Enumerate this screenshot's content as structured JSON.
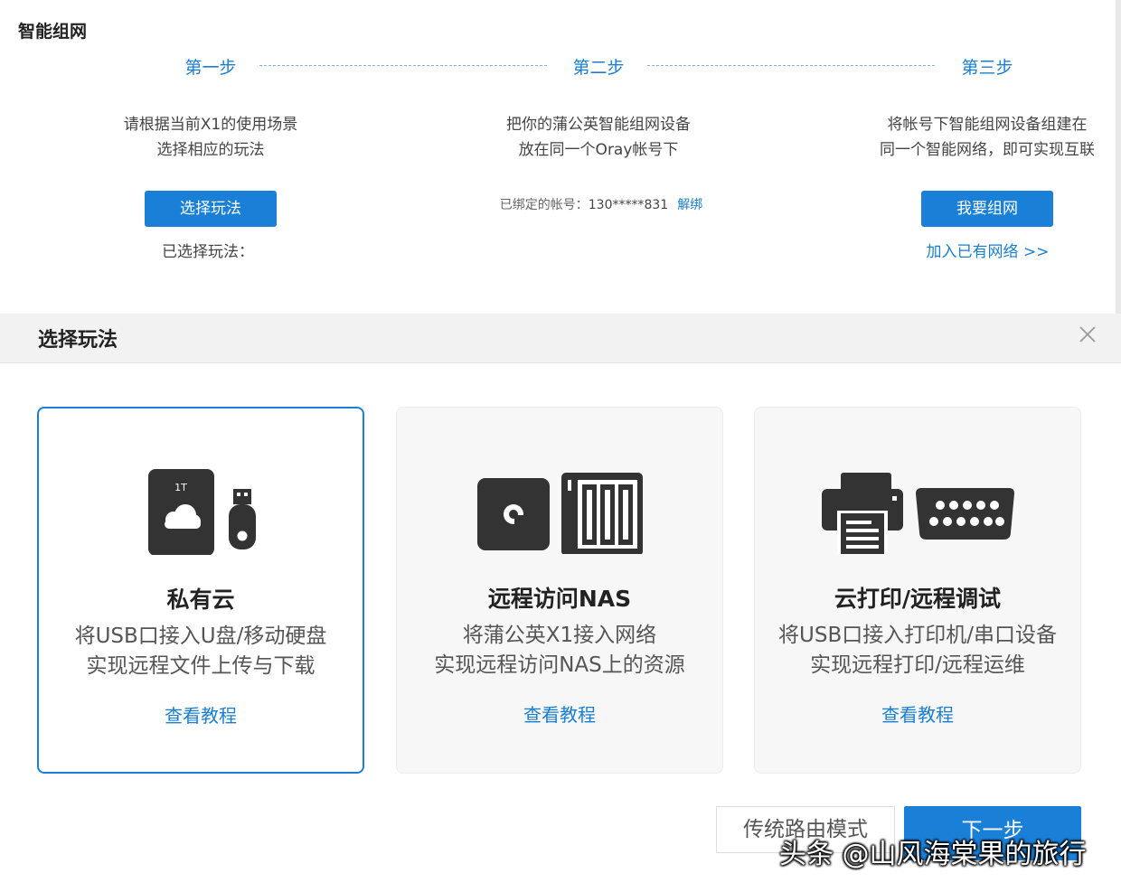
{
  "app": {
    "title": "智能组网"
  },
  "steps": [
    {
      "title": "第一步",
      "desc_line1": "请根据当前X1的使用场景",
      "desc_line2": "选择相应的玩法"
    },
    {
      "title": "第二步",
      "desc_line1": "把你的蒲公英智能组网设备",
      "desc_line2": "放在同一个Oray帐号下"
    },
    {
      "title": "第三步",
      "desc_line1": "将帐号下智能组网设备组建在",
      "desc_line2": "同一个智能网络，即可实现互联"
    }
  ],
  "step1": {
    "button_label": "选择玩法",
    "chosen_label": "已选择玩法："
  },
  "step2": {
    "bound_label": "已绑定的帐号：",
    "account": "130*****831",
    "unbind_label": "解绑"
  },
  "step3": {
    "button_label": "我要组网",
    "join_link": "加入已有网络 >>"
  },
  "modal": {
    "title": "选择玩法",
    "cards": [
      {
        "title": "私有云",
        "desc_line1": "将USB口接入U盘/移动硬盘",
        "desc_line2": "实现远程文件上传与下载",
        "link": "查看教程",
        "icon": "private-cloud-icon",
        "disk_label": "1T",
        "selected": true
      },
      {
        "title": "远程访问NAS",
        "desc_line1": "将蒲公英X1接入网络",
        "desc_line2": "实现远程访问NAS上的资源",
        "link": "查看教程",
        "icon": "nas-icon",
        "selected": false
      },
      {
        "title": "云打印/远程调试",
        "desc_line1": "将USB口接入打印机/串口设备",
        "desc_line2": "实现远程打印/远程运维",
        "link": "查看教程",
        "icon": "printer-serial-icon",
        "selected": false
      }
    ],
    "footer": {
      "secondary_button": "传统路由模式",
      "primary_button": "下一步"
    }
  },
  "watermark": "头条 @山风海棠果的旅行",
  "colors": {
    "accent": "#1a7fd6",
    "link": "#1a7fd0",
    "icon": "#333333"
  }
}
